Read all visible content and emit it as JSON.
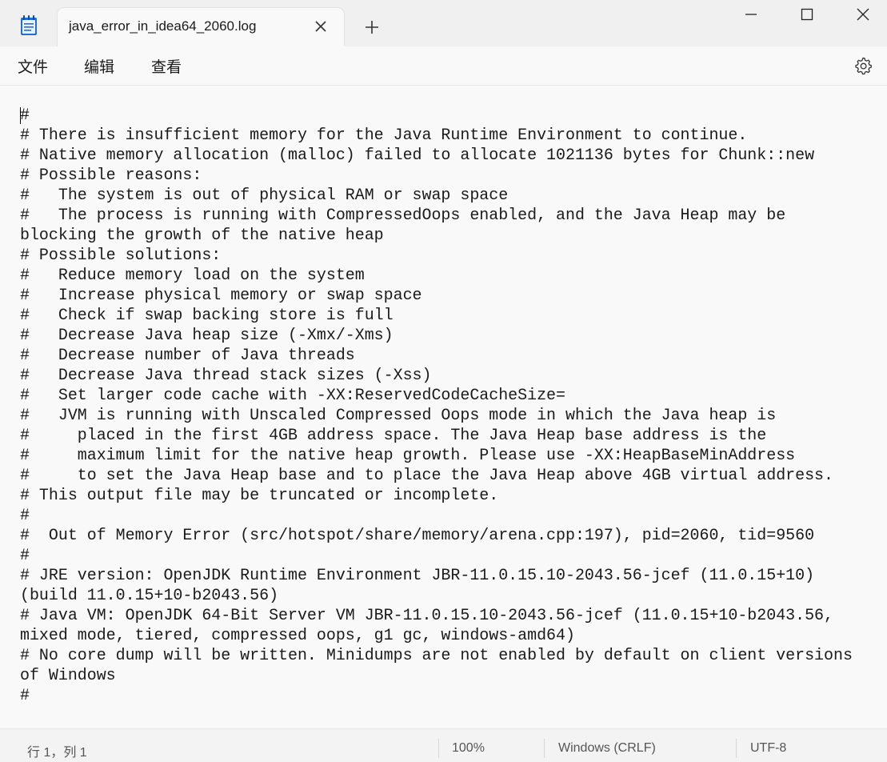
{
  "window": {
    "tab_title": "java_error_in_idea64_2060.log",
    "app_icon": "notepad-icon",
    "new_tab_icon": "plus-icon",
    "controls": [
      "minimize-icon",
      "maximize-icon",
      "close-icon"
    ]
  },
  "menu": {
    "file": "文件",
    "edit": "编辑",
    "view": "查看",
    "settings_icon": "gear-icon"
  },
  "editor": {
    "content": "#\n# There is insufficient memory for the Java Runtime Environment to continue.\n# Native memory allocation (malloc) failed to allocate 1021136 bytes for Chunk::new\n# Possible reasons:\n#   The system is out of physical RAM or swap space\n#   The process is running with CompressedOops enabled, and the Java Heap may be\nblocking the growth of the native heap\n# Possible solutions:\n#   Reduce memory load on the system\n#   Increase physical memory or swap space\n#   Check if swap backing store is full\n#   Decrease Java heap size (-Xmx/-Xms)\n#   Decrease number of Java threads\n#   Decrease Java thread stack sizes (-Xss)\n#   Set larger code cache with -XX:ReservedCodeCacheSize=\n#   JVM is running with Unscaled Compressed Oops mode in which the Java heap is\n#     placed in the first 4GB address space. The Java Heap base address is the\n#     maximum limit for the native heap growth. Please use -XX:HeapBaseMinAddress\n#     to set the Java Heap base and to place the Java Heap above 4GB virtual address.\n# This output file may be truncated or incomplete.\n#\n#  Out of Memory Error (src/hotspot/share/memory/arena.cpp:197), pid=2060, tid=9560\n#\n# JRE version: OpenJDK Runtime Environment JBR-11.0.15.10-2043.56-jcef (11.0.15+10)\n(build 11.0.15+10-b2043.56)\n# Java VM: OpenJDK 64-Bit Server VM JBR-11.0.15.10-2043.56-jcef (11.0.15+10-b2043.56,\nmixed mode, tiered, compressed oops, g1 gc, windows-amd64)\n# No core dump will be written. Minidumps are not enabled by default on client versions\nof Windows\n#"
  },
  "status": {
    "position": "行 1，列 1",
    "zoom": "100%",
    "line_ending": "Windows (CRLF)",
    "encoding": "UTF-8"
  },
  "colors": {
    "background": "#f9f9f9",
    "chrome": "#f0f0f0",
    "text": "#1a1a1a",
    "status_text": "#555555",
    "notepad_blue": "#1e6fd9"
  }
}
